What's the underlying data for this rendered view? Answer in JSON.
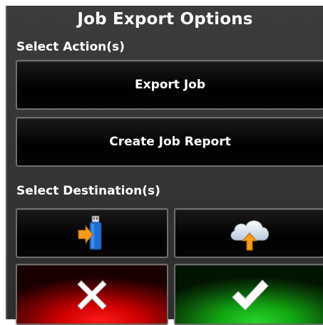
{
  "dialog": {
    "title": "Job Export Options"
  },
  "actions": {
    "label": "Select Action(s)",
    "export_job": "Export Job",
    "create_report": "Create Job Report"
  },
  "destinations": {
    "label": "Select Destination(s)",
    "usb_icon": "usb-drive-export-icon",
    "cloud_icon": "cloud-upload-icon"
  },
  "footer": {
    "cancel_icon": "close-x-icon",
    "confirm_icon": "checkmark-icon"
  },
  "colors": {
    "cancel": "#d00000",
    "confirm": "#11a411",
    "arrow": "#f59a1a",
    "usb": "#1f6fd1"
  }
}
